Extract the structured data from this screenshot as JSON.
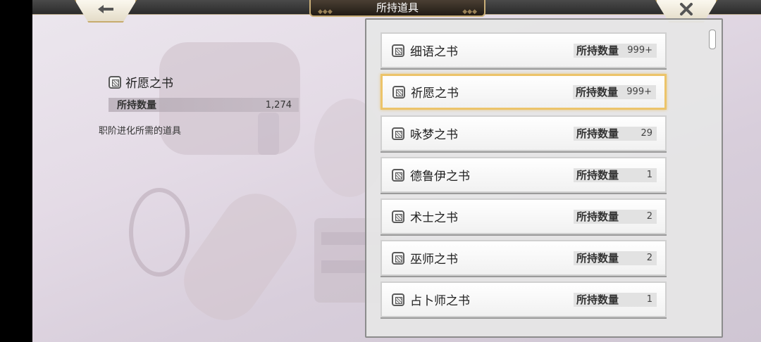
{
  "header": {
    "title": "所持道具"
  },
  "detail": {
    "name": "祈愿之书",
    "qty_label": "所持数量",
    "qty_value": "1,274",
    "description": "职阶进化所需的道具"
  },
  "items": [
    {
      "name": "细语之书",
      "qty_label": "所持数量",
      "qty": "999+"
    },
    {
      "name": "祈愿之书",
      "qty_label": "所持数量",
      "qty": "999+"
    },
    {
      "name": "咏梦之书",
      "qty_label": "所持数量",
      "qty": "29"
    },
    {
      "name": "德鲁伊之书",
      "qty_label": "所持数量",
      "qty": "1"
    },
    {
      "name": "术士之书",
      "qty_label": "所持数量",
      "qty": "2"
    },
    {
      "name": "巫师之书",
      "qty_label": "所持数量",
      "qty": "2"
    },
    {
      "name": "占卜师之书",
      "qty_label": "所持数量",
      "qty": "1"
    }
  ],
  "selected_index": 1,
  "colors": {
    "selected_border": "#ecc46a",
    "frame_gold": "#c9ae78"
  }
}
